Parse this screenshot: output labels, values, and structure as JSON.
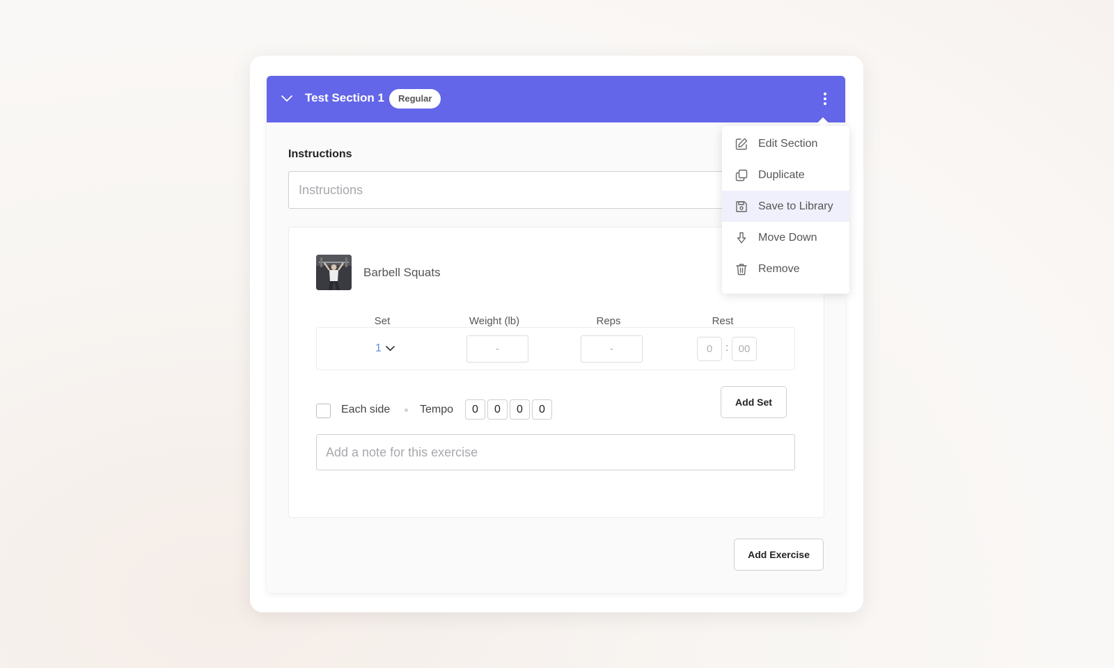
{
  "section": {
    "title": "Test Section 1",
    "badge": "Regular"
  },
  "instructions": {
    "label": "Instructions",
    "placeholder": "Instructions"
  },
  "exercise": {
    "name": "Barbell Squats",
    "columns": [
      "Set",
      "Weight (lb)",
      "Reps",
      "Rest"
    ],
    "set_row": {
      "set": "1",
      "weight": "-",
      "reps": "-",
      "rest_minutes": "0",
      "rest_seconds": "00",
      "rest_separator": ":"
    },
    "each_side_label": "Each side",
    "tempo_label": "Tempo",
    "tempo": [
      "0",
      "0",
      "0",
      "0"
    ],
    "add_set_label": "Add Set",
    "note_placeholder": "Add a note for this exercise"
  },
  "add_exercise_label": "Add Exercise",
  "menu": {
    "items": [
      {
        "label": "Edit Section",
        "icon": "edit-icon"
      },
      {
        "label": "Duplicate",
        "icon": "duplicate-icon"
      },
      {
        "label": "Save to Library",
        "icon": "save-icon"
      },
      {
        "label": "Move Down",
        "icon": "arrow-down-icon"
      },
      {
        "label": "Remove",
        "icon": "trash-icon"
      }
    ],
    "active_index": 2
  },
  "colors": {
    "header": "#6366e8",
    "set_link": "#5b8fd8",
    "menu_highlight": "#eff0fb"
  }
}
